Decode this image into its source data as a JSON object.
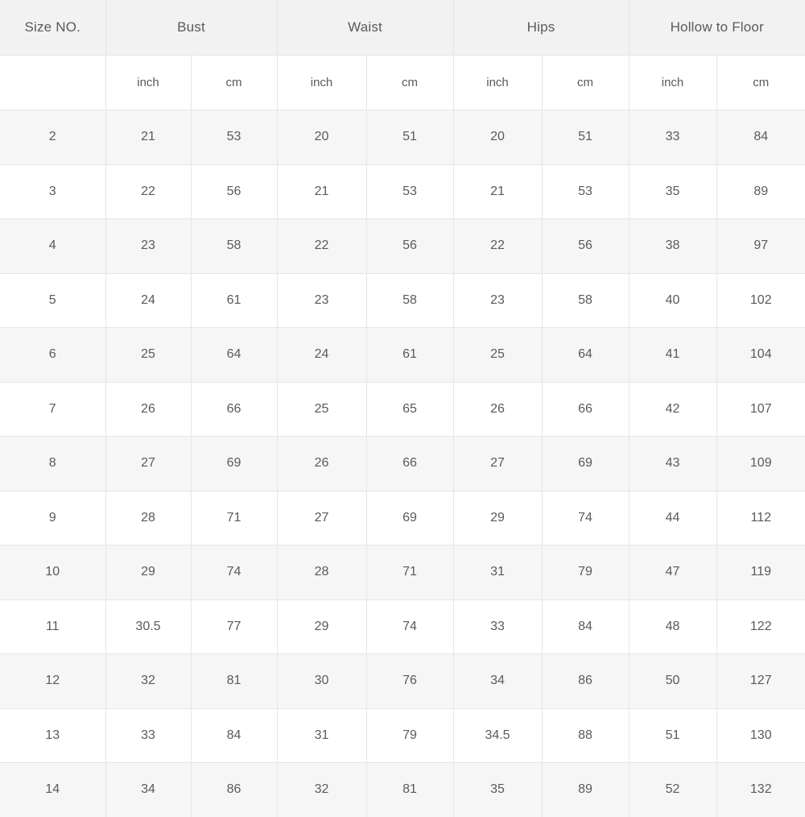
{
  "table": {
    "groups": [
      {
        "label": "Size NO.",
        "span": 1
      },
      {
        "label": "Bust",
        "span": 2
      },
      {
        "label": "Waist",
        "span": 2
      },
      {
        "label": "Hips",
        "span": 2
      },
      {
        "label": "Hollow to Floor",
        "span": 2
      }
    ],
    "units": [
      "",
      "inch",
      "cm",
      "inch",
      "cm",
      "inch",
      "cm",
      "inch",
      "cm"
    ],
    "rows": [
      {
        "size": "2",
        "cells": [
          "21",
          "53",
          "20",
          "51",
          "20",
          "51",
          "33",
          "84"
        ]
      },
      {
        "size": "3",
        "cells": [
          "22",
          "56",
          "21",
          "53",
          "21",
          "53",
          "35",
          "89"
        ]
      },
      {
        "size": "4",
        "cells": [
          "23",
          "58",
          "22",
          "56",
          "22",
          "56",
          "38",
          "97"
        ]
      },
      {
        "size": "5",
        "cells": [
          "24",
          "61",
          "23",
          "58",
          "23",
          "58",
          "40",
          "102"
        ]
      },
      {
        "size": "6",
        "cells": [
          "25",
          "64",
          "24",
          "61",
          "25",
          "64",
          "41",
          "104"
        ]
      },
      {
        "size": "7",
        "cells": [
          "26",
          "66",
          "25",
          "65",
          "26",
          "66",
          "42",
          "107"
        ]
      },
      {
        "size": "8",
        "cells": [
          "27",
          "69",
          "26",
          "66",
          "27",
          "69",
          "43",
          "109"
        ]
      },
      {
        "size": "9",
        "cells": [
          "28",
          "71",
          "27",
          "69",
          "29",
          "74",
          "44",
          "112"
        ]
      },
      {
        "size": "10",
        "cells": [
          "29",
          "74",
          "28",
          "71",
          "31",
          "79",
          "47",
          "119"
        ]
      },
      {
        "size": "11",
        "cells": [
          "30.5",
          "77",
          "29",
          "74",
          "33",
          "84",
          "48",
          "122"
        ]
      },
      {
        "size": "12",
        "cells": [
          "32",
          "81",
          "30",
          "76",
          "34",
          "86",
          "50",
          "127"
        ]
      },
      {
        "size": "13",
        "cells": [
          "33",
          "84",
          "31",
          "79",
          "34.5",
          "88",
          "51",
          "130"
        ]
      },
      {
        "size": "14",
        "cells": [
          "34",
          "86",
          "32",
          "81",
          "35",
          "89",
          "52",
          "132"
        ]
      }
    ]
  },
  "colors": {
    "header_bg": "#f2f2f2",
    "shade_row_bg": "#f6f6f6",
    "plain_row_bg": "#ffffff",
    "grid_line": "#e6e6e6",
    "text": "#5a5a5a"
  }
}
